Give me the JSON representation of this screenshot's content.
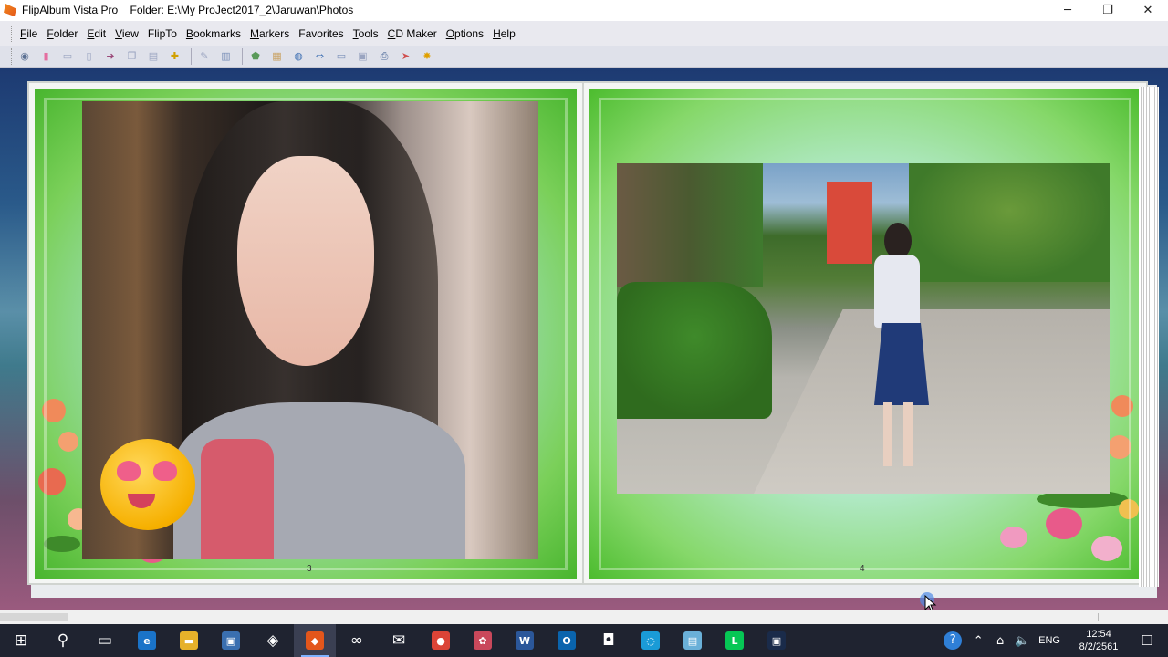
{
  "window": {
    "title": "FlipAlbum Vista Pro    Folder: E:\\My ProJect2017_2\\Jaruwan\\Photos",
    "controls": {
      "minimize": "─",
      "maximize": "❐",
      "close": "✕"
    }
  },
  "menu": [
    {
      "key": "F",
      "rest": "ile"
    },
    {
      "key": "F",
      "rest": "older"
    },
    {
      "key": "E",
      "rest": "dit"
    },
    {
      "key": "V",
      "rest": "iew"
    },
    {
      "key": "",
      "rest": "FlipTo"
    },
    {
      "key": "B",
      "rest": "ookmarks"
    },
    {
      "key": "M",
      "rest": "arkers"
    },
    {
      "key": "",
      "rest": "Favorites"
    },
    {
      "key": "T",
      "rest": "ools"
    },
    {
      "key": "C",
      "rest": "D Maker"
    },
    {
      "key": "O",
      "rest": "ptions"
    },
    {
      "key": "H",
      "rest": "elp"
    }
  ],
  "toolbar_icons": [
    {
      "name": "eye-icon",
      "glyph": "◉",
      "color": "#5a6f92"
    },
    {
      "name": "bookmark-icon",
      "glyph": "▮",
      "color": "#e46ea0"
    },
    {
      "name": "open-book-icon",
      "glyph": "▭",
      "color": "#9aa4c0"
    },
    {
      "name": "page-icon",
      "glyph": "▯",
      "color": "#9aa4c0"
    },
    {
      "name": "arrow-icon",
      "glyph": "➜",
      "color": "#9b4a7a"
    },
    {
      "name": "copy-icon",
      "glyph": "❐",
      "color": "#9aa4c0"
    },
    {
      "name": "paste-icon",
      "glyph": "▤",
      "color": "#9aa4c0"
    },
    {
      "name": "add-icon",
      "glyph": "✚",
      "color": "#d1a000"
    },
    {
      "name": "pen-icon",
      "glyph": "✎",
      "color": "#9aa4c0"
    },
    {
      "name": "columns-icon",
      "glyph": "▥",
      "color": "#7a8fb8"
    },
    {
      "name": "tag-icon",
      "glyph": "⬟",
      "color": "#5a9a5a"
    },
    {
      "name": "album-icon",
      "glyph": "▦",
      "color": "#c8a060"
    },
    {
      "name": "globe-icon",
      "glyph": "◍",
      "color": "#4d7ab8"
    },
    {
      "name": "fit-width-icon",
      "glyph": "⇔",
      "color": "#4d7ab8"
    },
    {
      "name": "slideshow-icon",
      "glyph": "▭",
      "color": "#7a8fb8"
    },
    {
      "name": "film-icon",
      "glyph": "▣",
      "color": "#9aa4c0"
    },
    {
      "name": "printer-icon",
      "glyph": "⎙",
      "color": "#4d6a9a"
    },
    {
      "name": "pointer-icon",
      "glyph": "➤",
      "color": "#d05050"
    },
    {
      "name": "star-icon",
      "glyph": "✸",
      "color": "#e0a000"
    }
  ],
  "pages": {
    "left_number": "3",
    "right_number": "4"
  },
  "taskbar": {
    "icons": [
      {
        "name": "start-icon",
        "glyph": "⊞",
        "bg": "",
        "active": false
      },
      {
        "name": "search-icon",
        "glyph": "⚲",
        "bg": "",
        "active": false
      },
      {
        "name": "task-view-icon",
        "glyph": "▭",
        "bg": "",
        "active": false
      },
      {
        "name": "edge-icon",
        "glyph": "e",
        "bg": "#1a73c8",
        "active": false
      },
      {
        "name": "file-explorer-icon",
        "glyph": "▬",
        "bg": "#e6b12a",
        "active": false
      },
      {
        "name": "store-icon",
        "glyph": "▣",
        "bg": "#3a6fb0",
        "active": false
      },
      {
        "name": "dropbox-icon",
        "glyph": "◈",
        "bg": "",
        "active": false
      },
      {
        "name": "flipalbum-icon",
        "glyph": "◆",
        "bg": "#e3561b",
        "active": true
      },
      {
        "name": "infinity-icon",
        "glyph": "∞",
        "bg": "",
        "active": false
      },
      {
        "name": "mail-icon",
        "glyph": "✉",
        "bg": "",
        "active": false
      },
      {
        "name": "chrome-icon",
        "glyph": "●",
        "bg": "#db4437",
        "active": false
      },
      {
        "name": "paint-icon",
        "glyph": "✿",
        "bg": "#c9485b",
        "active": false
      },
      {
        "name": "word-icon",
        "glyph": "W",
        "bg": "#2b579a",
        "active": false
      },
      {
        "name": "outlook-icon",
        "glyph": "O",
        "bg": "#0a64ad",
        "active": false
      },
      {
        "name": "camera-icon",
        "glyph": "◘",
        "bg": "",
        "active": false
      },
      {
        "name": "app-blue-icon",
        "glyph": "◌",
        "bg": "#1a9bd7",
        "active": false
      },
      {
        "name": "notepad-icon",
        "glyph": "▤",
        "bg": "#6ab0d8",
        "active": false
      },
      {
        "name": "line-icon",
        "glyph": "L",
        "bg": "#06c755",
        "active": false
      },
      {
        "name": "media-icon",
        "glyph": "▣",
        "bg": "#1a2b4a",
        "active": false
      }
    ],
    "tray": {
      "help_icon": "?",
      "chevron_icon": "⌃",
      "network_icon": "⌂",
      "volume_icon": "🔈",
      "language": "ENG",
      "time": "12:54",
      "date": "8/2/2561",
      "notification_icon": "☐"
    }
  }
}
